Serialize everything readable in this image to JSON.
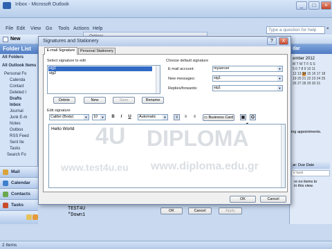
{
  "app": {
    "window_title": "Inbox - Microsoft Outlook"
  },
  "menubar": [
    "File",
    "Edit",
    "View",
    "Go",
    "Tools",
    "Actions",
    "Help"
  ],
  "toolbar": {
    "new_label": "New"
  },
  "ask_box": {
    "placeholder": "Type a question for help"
  },
  "background_window": {
    "title": "Options"
  },
  "folder_pane": {
    "title": "Folder List",
    "subtitle": "All Folders",
    "all_items_label": "All Outlook Items",
    "folders": [
      "Personal Fo",
      "Calenda",
      "Contact",
      "Deleted I",
      "Drafts",
      "Inbox",
      "Journal",
      "Junk E-m",
      "Notes",
      "Outbox",
      "RSS Feed",
      "Sent Ite",
      "Tasks",
      "Search Fo"
    ]
  },
  "nav_buttons": [
    {
      "label": "Mail",
      "color": "#d9a33a"
    },
    {
      "label": "Calendar",
      "color": "#3f7fce"
    },
    {
      "label": "Contacts",
      "color": "#6aa84f"
    },
    {
      "label": "Tasks",
      "color": "#c94b2c"
    }
  ],
  "todo_bar": {
    "title": "dar",
    "month": "ember 2012",
    "no_appointments": "ing appointments.",
    "task_header": "ar: Due Date",
    "task_placeholder": "v task",
    "no_items": "re no items to\nin this view."
  },
  "status": {
    "items": "2 Items"
  },
  "preview_text": {
    "line1": "TEST4U",
    "line2": "\"Down1"
  },
  "dialog": {
    "title": "Signatures and Stationery",
    "help_button": "?",
    "close_button": "X",
    "tabs": [
      "E-mail Signature",
      "Personal Stationery"
    ],
    "select_label": "Select signature to edit",
    "signatures": [
      "sig1",
      "sig2"
    ],
    "buttons": {
      "delete": "Delete",
      "new": "New",
      "save": "Save",
      "rename": "Rename"
    },
    "default_section": "Choose default signature",
    "email_account_label": "E-mail account:",
    "email_account_value": "myserver",
    "new_messages_label": "New messages:",
    "new_messages_value": "sig1",
    "replies_label": "Replies/forwards:",
    "replies_value": "sig1",
    "edit_label": "Edit signature",
    "font_value": "Calibri (Body)",
    "size_value": "10",
    "color_value": "Automatic",
    "business_card": "Business Card",
    "editor_text": "Hello World",
    "ok": "OK",
    "cancel": "Cancel"
  },
  "bottom_buttons": {
    "ok": "OK",
    "cancel": "Cancel",
    "apply": "Apply"
  },
  "watermark": {
    "brand_left": "4U",
    "brand_right": "DIPLOMA",
    "url_left": "www.test4u.eu",
    "url_right": "www.diploma.edu.gr"
  }
}
